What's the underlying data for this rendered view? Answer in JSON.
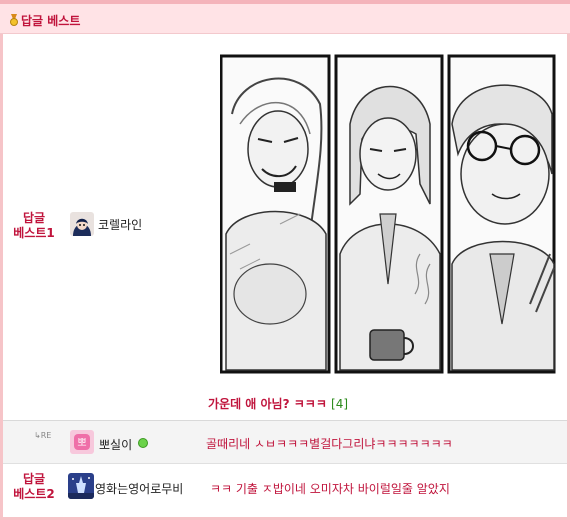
{
  "header": {
    "title": "답글 베스트",
    "icon": "medal-icon"
  },
  "best1": {
    "label_line1": "답글",
    "label_line2": "베스트1",
    "nickname": "코렐라인",
    "caption": "가운데 애 아님? ㅋㅋㅋ",
    "reply_count": "[4]"
  },
  "reply": {
    "re_mark": "↳RE",
    "nickname": "뽀실이",
    "text": "골때리네 ㅅㅂㅋㅋㅋ별걸다그리냐ㅋㅋㅋㅋㅋㅋㅋ"
  },
  "best2": {
    "label_line1": "답글",
    "label_line2": "베스트2",
    "nickname": "영화는영어로무비",
    "text": "ㅋㅋ 기출 ㅈ밥이네 오미자차 바이럴일줄 알았지"
  },
  "colors": {
    "accent": "#c0143c",
    "header_bg": "#ffe3e6",
    "count_green": "#2a8a1a"
  }
}
